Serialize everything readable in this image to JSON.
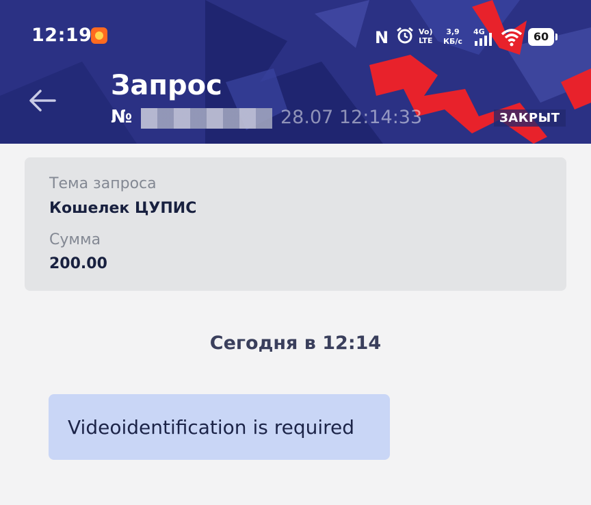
{
  "status_bar": {
    "time": "12:19",
    "nfc": "N",
    "volte": [
      "Vo)",
      "LTE"
    ],
    "speed": [
      "3,9",
      "КБ/с"
    ],
    "network": "4G",
    "battery": "60",
    "icons": [
      "app-notification-icon",
      "nfc-icon",
      "alarm-icon",
      "volte-icon",
      "signal-icon",
      "wifi-icon",
      "battery-icon"
    ]
  },
  "header": {
    "title": "Запрос",
    "number_prefix": "№ ",
    "datetime": "28.07 12:14:33",
    "status": "ЗАКРЫТ",
    "back_icon": "arrow-left-icon",
    "colors": {
      "background": "#2b3184",
      "accent": "#e8222b"
    }
  },
  "details": {
    "topic_label": "Тема запроса",
    "topic_value": "Кошелек ЦУПИС",
    "amount_label": "Сумма",
    "amount_value": "200.00"
  },
  "chat": {
    "date_separator": "Сегодня в 12:14",
    "messages": [
      {
        "text": "Videoidentification is required"
      }
    ]
  }
}
